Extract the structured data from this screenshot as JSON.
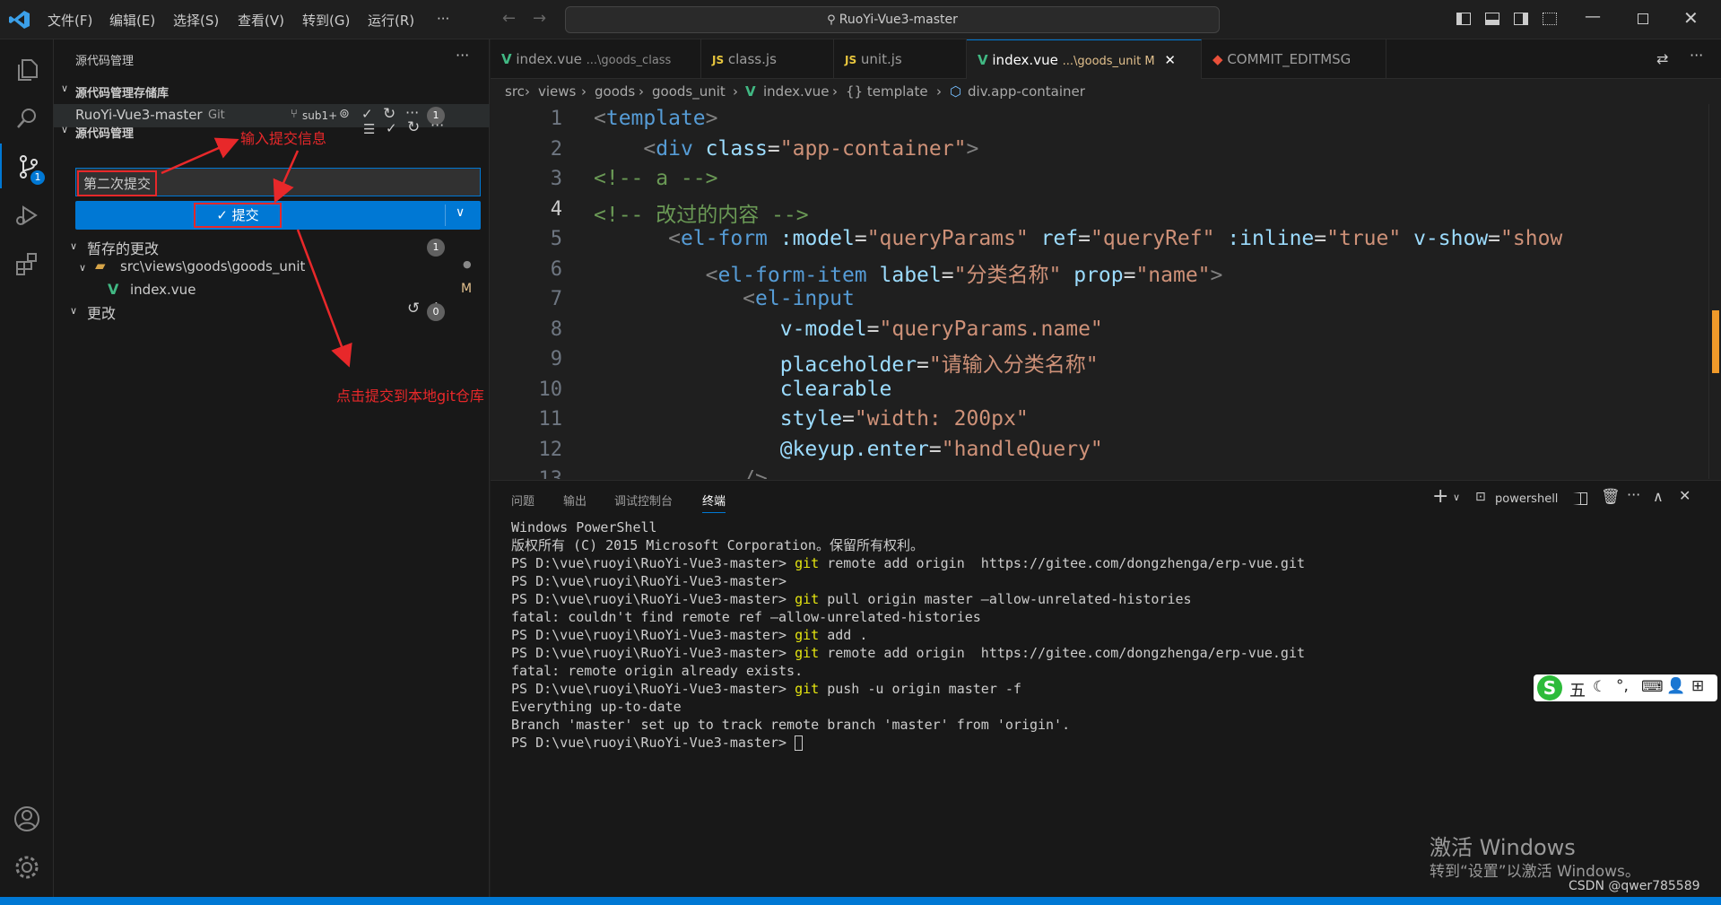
{
  "titlebar": {
    "menus": [
      "文件(F)",
      "编辑(E)",
      "选择(S)",
      "查看(V)",
      "转到(G)",
      "运行(R)",
      "···"
    ],
    "search_text": "RuoYi-Vue3-master"
  },
  "sidebar": {
    "header": "源代码管理",
    "repos_section": "源代码管理存储库",
    "repo_name": "RuoYi-Vue3-master",
    "repo_type": "Git",
    "branch": "sub1+",
    "repo_count": "1",
    "scm_section": "源代码管理",
    "commit_message": "第二次提交",
    "commit_button": "✓ 提交",
    "staged_label": "暂存的更改",
    "staged_count": "1",
    "folder_path": "src\\views\\goods\\goods_unit",
    "file_name": "index.vue",
    "file_status": "M",
    "changes_label": "更改",
    "changes_count": "0"
  },
  "annotations": {
    "input_hint": "输入提交信息",
    "commit_hint": "点击提交到本地git仓库"
  },
  "tabs": [
    {
      "label": "index.vue",
      "desc": "...\\goods_class"
    },
    {
      "label": "class.js",
      "desc": ""
    },
    {
      "label": "unit.js",
      "desc": ""
    },
    {
      "label": "index.vue",
      "desc": "...\\goods_unit M"
    },
    {
      "label": "COMMIT_EDITMSG",
      "desc": ""
    }
  ],
  "breadcrumb": [
    "src",
    "views",
    "goods",
    "goods_unit",
    "index.vue",
    "{} template",
    "div.app-container"
  ],
  "editor": {
    "line_numbers": [
      "1",
      "2",
      "3",
      "4",
      "5",
      "6",
      "7",
      "8",
      "9",
      "10",
      "11",
      "12",
      "13"
    ]
  },
  "panel": {
    "tabs": [
      "问题",
      "输出",
      "调试控制台",
      "终端"
    ],
    "shell": "powershell",
    "terminal_lines": [
      "Windows PowerShell",
      "版权所有 (C) 2015 Microsoft Corporation。保留所有权利。",
      "",
      "PS D:\\vue\\ruoyi\\RuoYi-Vue3-master> git remote add origin  https://gitee.com/dongzhenga/erp-vue.git",
      "PS D:\\vue\\ruoyi\\RuoYi-Vue3-master>",
      "PS D:\\vue\\ruoyi\\RuoYi-Vue3-master> git pull origin master –allow-unrelated-histories",
      "fatal: couldn't find remote ref –allow-unrelated-histories",
      "PS D:\\vue\\ruoyi\\RuoYi-Vue3-master> git add .",
      "PS D:\\vue\\ruoyi\\RuoYi-Vue3-master> git remote add origin  https://gitee.com/dongzhenga/erp-vue.git",
      "fatal: remote origin already exists.",
      "PS D:\\vue\\ruoyi\\RuoYi-Vue3-master> git push -u origin master -f",
      "Everything up-to-date",
      "Branch 'master' set up to track remote branch 'master' from 'origin'.",
      "PS D:\\vue\\ruoyi\\RuoYi-Vue3-master> "
    ]
  },
  "ime": {
    "label": "五"
  },
  "watermark": {
    "line1": "激活 Windows",
    "line2": "转到“设置”以激活 Windows。",
    "csdn": "CSDN @qwer785589"
  },
  "colors": {
    "accent": "#0078d4",
    "annotation": "#e8282a"
  }
}
